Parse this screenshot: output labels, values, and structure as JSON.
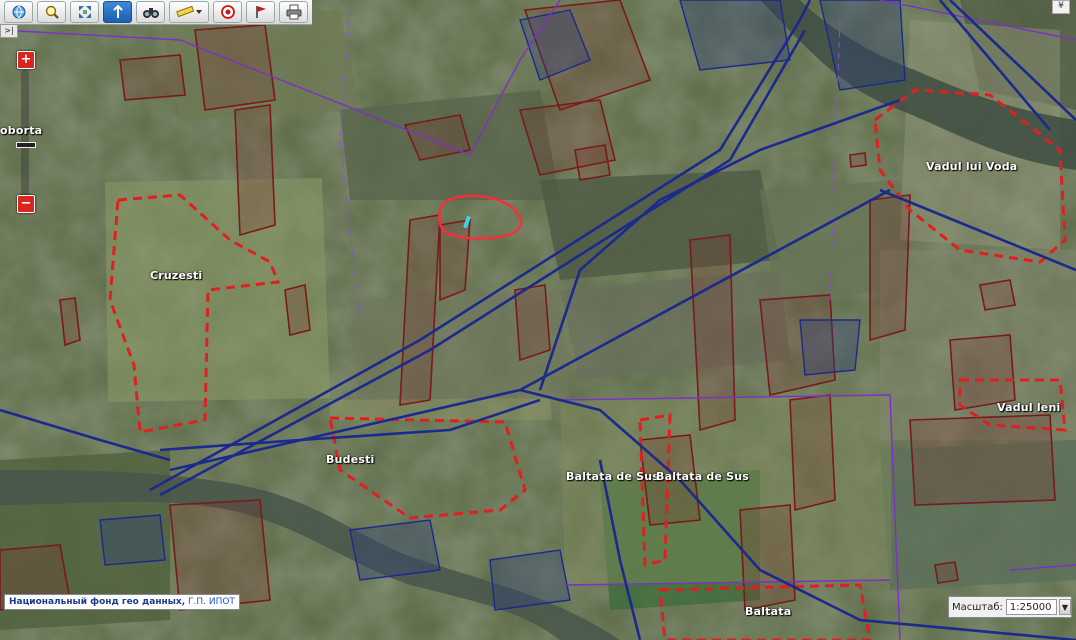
{
  "toolbar": {
    "tools": [
      {
        "name": "home-tool",
        "icon": "globe-icon"
      },
      {
        "name": "search-tool",
        "icon": "magnifier-icon"
      },
      {
        "name": "extent-tool",
        "icon": "arrows-icon"
      },
      {
        "name": "identify-tool",
        "icon": "pointer-icon",
        "active": true
      },
      {
        "name": "binoculars-tool",
        "icon": "binoculars-icon"
      },
      {
        "name": "measure-tool",
        "icon": "ruler-icon"
      },
      {
        "name": "target-tool",
        "icon": "target-icon"
      },
      {
        "name": "flag-tool",
        "icon": "flag-icon"
      },
      {
        "name": "print-tool",
        "icon": "printer-icon"
      }
    ],
    "collapse_symbol": "¥",
    "sidebar_toggle_symbol": ">|"
  },
  "zoom": {
    "in_label": "+",
    "out_label": "−"
  },
  "labels": {
    "boroberta": "oborta",
    "cruzesti": "Cruzesti",
    "vadul_lui_voda": "Vadul lui Voda",
    "budesti": "Budesti",
    "baltata_de_sus": "Baltata de Sus",
    "baltata_de_sus_2": "Baltata de Sus",
    "vadul_leni": "Vadul leni",
    "baltata": "Baltata"
  },
  "attribution": {
    "text": "Национальный фонд гео данных,",
    "link": " Г.П. ИПОТ"
  },
  "scale": {
    "label": "Масштаб:",
    "value": "1:25000",
    "arrow": "▼"
  },
  "colors": {
    "parcel_outline": "#7a1a1a",
    "locality_boundary": "#e02020",
    "road_line": "#1b2a8c",
    "district_line": "#7d30c8",
    "marked_area": "#ff2a3a",
    "marker": "#3fd3e8"
  }
}
